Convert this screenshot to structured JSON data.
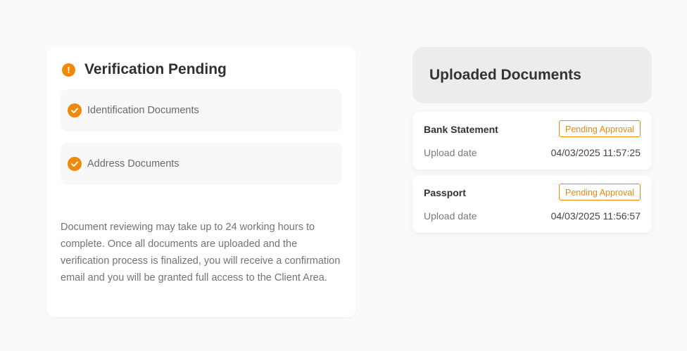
{
  "verification": {
    "title": "Verification Pending",
    "icon": "exclamation-icon",
    "documents": [
      {
        "label": "Identification Documents",
        "icon": "check-circle-icon"
      },
      {
        "label": "Address Documents",
        "icon": "check-circle-icon"
      }
    ],
    "note": "Document reviewing may take up to 24 working hours to complete. Once all documents are uploaded and the verification process is finalized, you will receive a confirmation email and you will be granted full access to the Client Area."
  },
  "uploaded": {
    "title": "Uploaded Documents",
    "items": [
      {
        "name": "Bank Statement",
        "status": "Pending Approval",
        "date_label": "Upload date",
        "date_value": "04/03/2025 11:57:25"
      },
      {
        "name": "Passport",
        "status": "Pending Approval",
        "date_label": "Upload date",
        "date_value": "04/03/2025 11:56:57"
      }
    ]
  },
  "colors": {
    "accent": "#f0890a",
    "page_bg": "#fafafa",
    "header_bg": "#ececec"
  }
}
